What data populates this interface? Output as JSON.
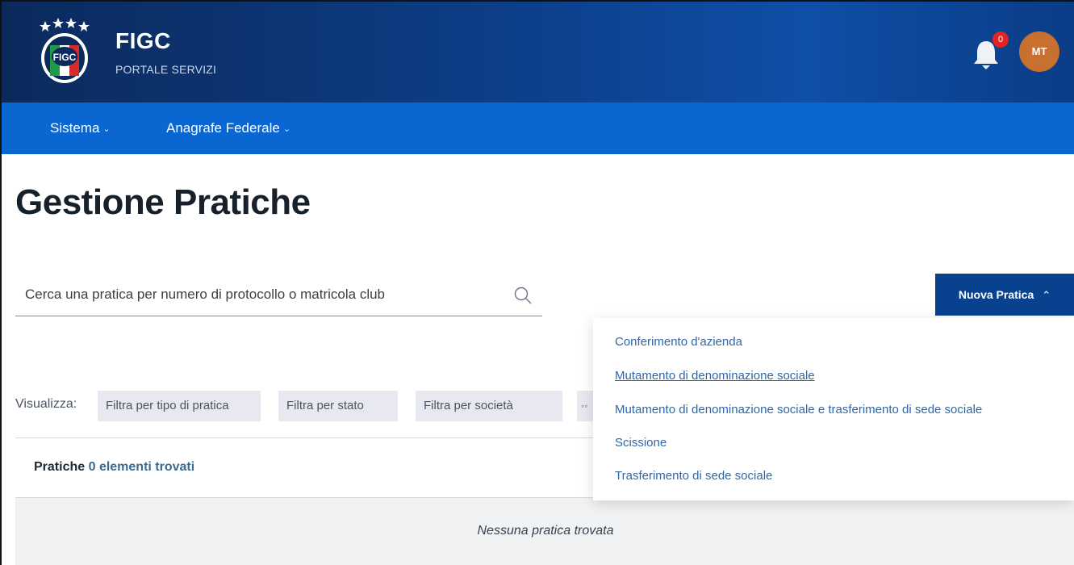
{
  "header": {
    "brand_title": "FIGC",
    "brand_subtitle": "PORTALE SERVIZI",
    "logo_text": "FIGC",
    "notifications_count": "0",
    "avatar_initials": "MT"
  },
  "nav": {
    "items": [
      {
        "label": "Sistema"
      },
      {
        "label": "Anagrafe Federale"
      }
    ]
  },
  "main": {
    "page_title": "Gestione Pratiche",
    "search": {
      "placeholder": "Cerca una pratica per numero di protocollo o matricola club",
      "value": ""
    },
    "new_button_label": "Nuova Pratica",
    "filters": {
      "label": "Visualizza:",
      "chips": [
        "Filtra per tipo di pratica",
        "Filtra per stato",
        "Filtra per società"
      ],
      "more_chip": "◦◦"
    },
    "list": {
      "title": "Pratiche",
      "count_text": "0 elementi trovati",
      "empty_message": "Nessuna pratica trovata"
    }
  },
  "dropdown": {
    "items": [
      "Conferimento d'azienda",
      "Mutamento di denominazione sociale",
      "Mutamento di denominazione sociale e trasferimento di sede sociale",
      "Scissione",
      "Trasferimento di sede sociale"
    ],
    "hovered_index": 1
  },
  "colors": {
    "header_bg": "#0d3d86",
    "nav_bg": "#0a66d0",
    "primary_button": "#08418e",
    "link": "#2f67a8",
    "badge": "#e02424",
    "avatar": "#c8702f"
  },
  "icons": [
    "figc-logo-icon",
    "bell-icon",
    "chevron-down-icon",
    "search-icon",
    "chevron-up-icon"
  ]
}
